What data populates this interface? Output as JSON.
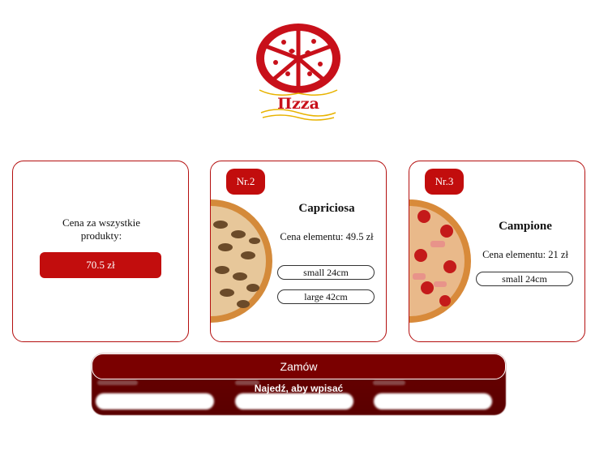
{
  "logo": {
    "text": "Πzza"
  },
  "summary": {
    "label": "Cena za wszystkie produkty:",
    "total": "70.5 zł"
  },
  "products": [
    {
      "badge": "Nr.2",
      "name": "Capriciosa",
      "price_line": "Cena elementu: 49.5 zł",
      "sizes": [
        "small 24cm",
        "large 42cm"
      ]
    },
    {
      "badge": "Nr.3",
      "name": "Campione",
      "price_line": "Cena elementu: 21 zł",
      "sizes": [
        "small 24cm"
      ]
    }
  ],
  "order": {
    "button_label": "Zamów",
    "hover_hint": "Najedź, aby wpisać"
  },
  "colors": {
    "accent": "#c20d0d",
    "order_bg": "#6a0000"
  }
}
